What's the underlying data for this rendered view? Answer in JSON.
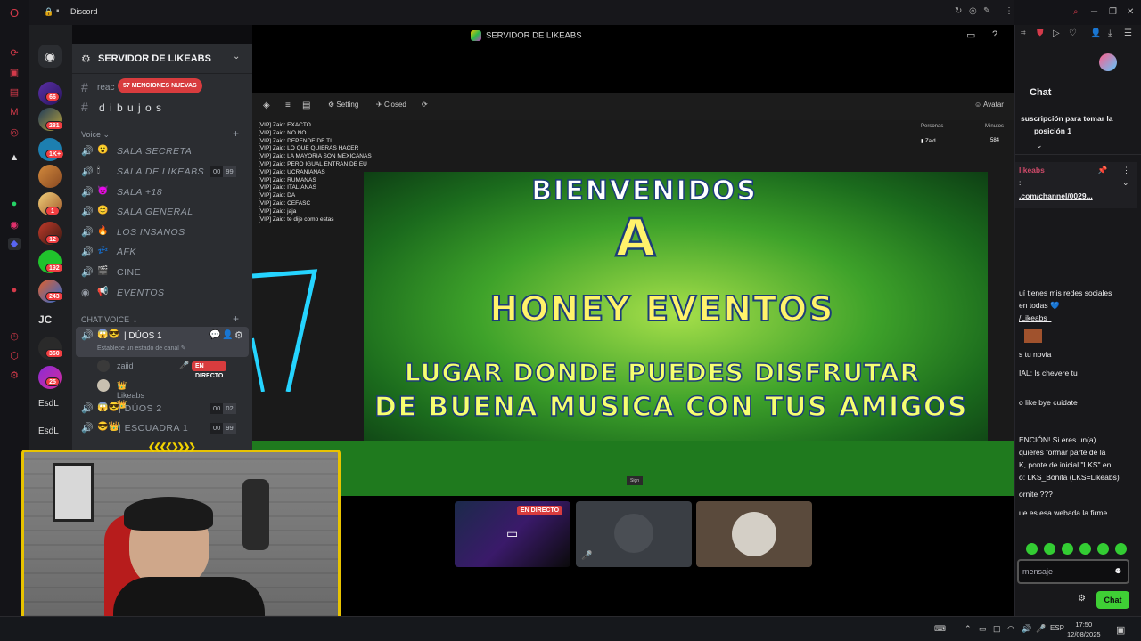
{
  "browser": {
    "tab_title": "Discord"
  },
  "discord": {
    "stream_title": "SERVIDOR DE LIKEABS",
    "server_name": "SERVIDOR DE LIKEABS",
    "mentions_pill": "57 MENCIONES NUEVAS",
    "text_channel_partial": "reac",
    "text_channel": "d i b u j o s",
    "servers": [
      {
        "badge": "66"
      },
      {
        "badge": "281"
      },
      {
        "badge": "1K+"
      },
      {
        "badge": "1"
      },
      {
        "badge": "12"
      },
      {
        "badge": "192"
      },
      {
        "badge": "243"
      },
      {
        "badge": ""
      },
      {
        "badge": "360"
      },
      {
        "badge": "25"
      }
    ],
    "server_text_1": "JC",
    "server_text_2": "EsdL",
    "server_text_3": "EsdL",
    "voice_category": "Voice",
    "voice_channels": [
      {
        "emoji": "😮",
        "label": "SALA SECRETA",
        "count_a": "",
        "count_b": ""
      },
      {
        "emoji": "🕯",
        "label": "SALA DE LIKEABS",
        "count_a": "00",
        "count_b": "99"
      },
      {
        "emoji": "😈",
        "label": "SALA +18",
        "count_a": "",
        "count_b": ""
      },
      {
        "emoji": "😊",
        "label": "SALA GENERAL",
        "count_a": "",
        "count_b": ""
      },
      {
        "emoji": "🔥",
        "label": "LOS INSANOS",
        "count_a": "",
        "count_b": ""
      },
      {
        "emoji": "💤",
        "label": "AFK",
        "count_a": "",
        "count_b": ""
      },
      {
        "emoji": "🎬",
        "label": "CINE",
        "count_a": "",
        "count_b": ""
      },
      {
        "emoji": "📢",
        "label": "EVENTOS",
        "count_a": "",
        "count_b": ""
      }
    ],
    "chat_voice_category": "CHAT VOICE",
    "duos1": {
      "label": "DÚOS 1",
      "status": "Establece un estado de canal"
    },
    "members": [
      {
        "name": "zaiid",
        "live": "EN DIRECTO"
      },
      {
        "name": "Likeabs",
        "crown": "👑"
      }
    ],
    "duos2": {
      "label": "DÚOS 2",
      "count_a": "00",
      "count_b": "02"
    },
    "escuadra1": {
      "label": "ESCUADRA 1",
      "count_a": "00",
      "count_b": "99"
    },
    "thumb_live": "EN DIRECTO"
  },
  "game": {
    "toolbar": {
      "setting": "Setting",
      "closed": "Closed",
      "avatar": "Avatar"
    },
    "chat_lines": [
      "[VIP] Zaid: EXACTO",
      "[VIP] Zaid: NO NO",
      "[VIP] Zaid: DEPENDE DE TI",
      "[VIP] Zaid: LO QUE QUIERAS HACER",
      "[VIP] Zaid: LA MAYORIA SON MEXICANAS",
      "[VIP] Zaid: PERO IGUAL ENTRAN DE EU",
      "[VIP] Zaid: UCRANIANAS",
      "[VIP] Zaid: RUMANAS",
      "[VIP] Zaid: ITALIANAS",
      "[VIP] Zaid: DA",
      "[VIP] Zaid: CEFASC",
      "[VIP] Zaid: jaja",
      "[VIP] Zaid: te dije como estas"
    ],
    "rank": {
      "col1": "Personas",
      "col2": "Minutos",
      "name": "Zaid",
      "value": "584"
    },
    "banner": {
      "line1": "BIENVENIDOS",
      "line2": "A",
      "line3": "HONEY EVENTOS",
      "line4": "LUGAR DONDE PUEDES DISFRUTAR",
      "line5": "DE BUENA MUSICA CON TUS AMIGOS"
    },
    "sign": "Sign"
  },
  "twitch": {
    "chat_title": "Chat",
    "pinned_text": "suscripción para tomar la",
    "pinned_text2": "posición 1",
    "pinned_author": "likeabs",
    "pinned_link": ".com/channel/0029...",
    "messages": [
      "uí tienes mis redes sociales",
      "en todas 💙",
      "/Likeabs_",
      "s tu novia",
      "IAL: ls chevere tu",
      "o like bye cuidate",
      "ENCIÓN! Si eres un(a)",
      "quieres formar parte de la",
      "K, ponte de inicial \"LKS\" en",
      "o: LKS_Bonita (LKS=Likeabs)",
      "ornite ???",
      "ue es esa webada la firme"
    ],
    "input_placeholder": "mensaje",
    "chat_button": "Chat"
  },
  "taskbar": {
    "lang": "ESP",
    "time": "17:50",
    "date": "12/08/2025"
  }
}
